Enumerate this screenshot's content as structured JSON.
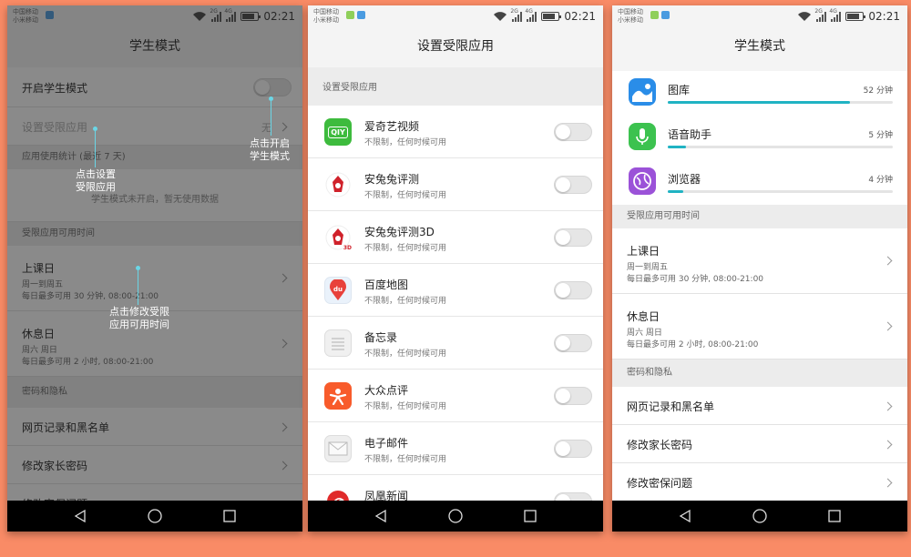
{
  "status": {
    "carrier1": "中国移动",
    "carrier2": "小米移动",
    "net_tag": "2G",
    "net_tag2": "4G",
    "time": "02:21"
  },
  "panel1": {
    "title": "学生模式",
    "enable_label": "开启学生模式",
    "restricted_label": "设置受限应用",
    "restricted_value": "无",
    "usage_section": "应用使用统计 (最近 7 天)",
    "no_data": "学生模式未开启，暂无使用数据",
    "time_section": "受限应用可用时间",
    "weekday_label": "上课日",
    "weekday_days": "周一到周五",
    "weekday_limit": "每日最多可用 30 分钟, 08:00-21:00",
    "weekend_label": "休息日",
    "weekend_days": "周六 周日",
    "weekend_limit": "每日最多可用 2 小时, 08:00-21:00",
    "privacy_section": "密码和隐私",
    "web_label": "网页记录和黑名单",
    "parent_pwd_label": "修改家长密码",
    "security_q_label": "修改密保问题",
    "callout_enable": [
      "点击开启",
      "学生模式"
    ],
    "callout_restricted": [
      "点击设置",
      "受限应用"
    ],
    "callout_time": [
      "点击修改受限",
      "应用可用时间"
    ]
  },
  "panel2": {
    "title": "设置受限应用",
    "section": "设置受限应用",
    "apps": [
      {
        "name": "爱奇艺视频",
        "sub": "不限制，任何时候可用",
        "icon": "iqiyi-icon",
        "color": "#3dbb3d"
      },
      {
        "name": "安兔兔评测",
        "sub": "不限制，任何时候可用",
        "icon": "antutu-icon",
        "color": "#ffffff"
      },
      {
        "name": "安兔兔评测3D",
        "sub": "不限制，任何时候可用",
        "icon": "antutu3d-icon",
        "color": "#ffffff"
      },
      {
        "name": "百度地图",
        "sub": "不限制，任何时候可用",
        "icon": "baidu-map-icon",
        "color": "#eaf2fb"
      },
      {
        "name": "备忘录",
        "sub": "不限制，任何时候可用",
        "icon": "memo-icon",
        "color": "#f0f0f0"
      },
      {
        "name": "大众点评",
        "sub": "不限制，任何时候可用",
        "icon": "dianping-icon",
        "color": "#f85b2b"
      },
      {
        "name": "电子邮件",
        "sub": "不限制，任何时候可用",
        "icon": "email-icon",
        "color": "#eeeeee"
      },
      {
        "name": "凤凰新闻",
        "sub": "",
        "icon": "ifeng-icon",
        "color": "#ffffff"
      }
    ],
    "iqiyi_glyph": "QIY",
    "antutu_3d_tag": "3D",
    "baidu_tag": "du"
  },
  "panel3": {
    "title": "学生模式",
    "usage": [
      {
        "name": "图库",
        "time": "52 分钟",
        "fraction": 0.81,
        "icon": "gallery-icon",
        "color": "#2a8de8"
      },
      {
        "name": "语音助手",
        "time": "5 分钟",
        "fraction": 0.08,
        "icon": "voice-assistant-icon",
        "color": "#3cc24f"
      },
      {
        "name": "浏览器",
        "time": "4 分钟",
        "fraction": 0.07,
        "icon": "browser-icon",
        "color": "#9b52d8"
      }
    ],
    "time_section": "受限应用可用时间",
    "weekday_label": "上课日",
    "weekday_days": "周一到周五",
    "weekday_limit": "每日最多可用 30 分钟, 08:00-21:00",
    "weekend_label": "休息日",
    "weekend_days": "周六 周日",
    "weekend_limit": "每日最多可用 2 小时, 08:00-21:00",
    "privacy_section": "密码和隐私",
    "web_label": "网页记录和黑名单",
    "parent_pwd_label": "修改家长密码",
    "security_q_label": "修改密保问题"
  },
  "colors": {
    "accent": "#20b3c3",
    "background": "#f98b66",
    "callout": "#6ad6e6"
  }
}
